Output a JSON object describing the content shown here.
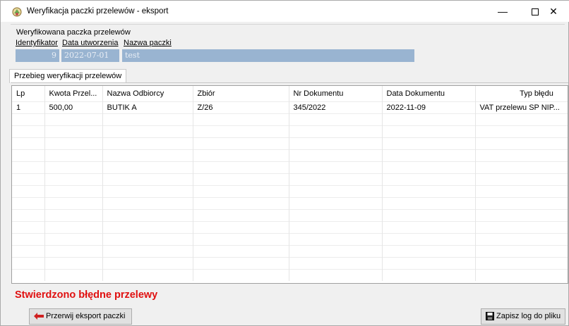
{
  "window": {
    "title": "Weryfikacja paczki przelewów - eksport",
    "minimize": "—",
    "close": "✕"
  },
  "batch": {
    "legend": "Weryfikowana paczka przelewów",
    "id_label": "Identyfikator",
    "date_label": "Data utworzenia",
    "name_label": "Nazwa paczki",
    "id_value": "9",
    "date_value": "2022-07-01",
    "name_value": "test"
  },
  "tab": {
    "label": "Przebieg weryfikacji przelewów"
  },
  "table": {
    "columns": [
      "Lp",
      "Kwota Przel...",
      "Nazwa Odbiorcy",
      "Zbiór",
      "Nr Dokumentu",
      "Data Dokumentu",
      "Typ błędu"
    ],
    "rows": [
      [
        "1",
        "500,00",
        "BUTIK A",
        "Z/26",
        "345/2022",
        "2022-11-09",
        "VAT przelewu SP NIP..."
      ]
    ]
  },
  "status": "Stwierdzono błędne przelewy",
  "buttons": {
    "abort": "Przerwij eksport paczki",
    "save_log": "Zapisz log do pliku"
  },
  "colors": {
    "status": "#e01010",
    "field_bg": "#99b4d1"
  }
}
